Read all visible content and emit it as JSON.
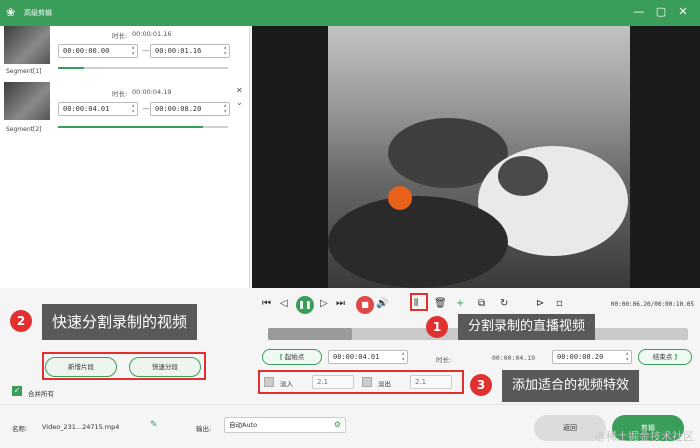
{
  "window": {
    "title": "高级剪辑",
    "logo_glyph": "❀",
    "minimize_glyph": "—",
    "maximize_glyph": "▢",
    "close_glyph": "✕"
  },
  "segments": [
    {
      "label": "Segment[1]",
      "duration_label": "时长:",
      "duration": "00:00:01.16",
      "start": "00:00:00.00",
      "end": "00:00:01.16",
      "progress": 0.15
    },
    {
      "label": "Segment[2]",
      "duration_label": "时长:",
      "duration": "00:00:04.19",
      "start": "00:00:04.01",
      "end": "00:00:08.20",
      "progress": 0.85
    }
  ],
  "controls": {
    "time_readout": "00:00:06.20/00:00:10.05",
    "timeline_progress": 0.2
  },
  "cut_bar": {
    "start_btn": "起始点",
    "start_time": "00:00:04.01",
    "duration_label": "时长:",
    "duration": "00:00:04.19",
    "end_time": "00:00:08.20",
    "end_btn": "结束点"
  },
  "effects": {
    "fade_in_label": "淡入",
    "fade_in_value": "2.1",
    "fade_out_label": "淡出",
    "fade_out_value": "2.1"
  },
  "left_buttons": {
    "new_segment": "新增片段",
    "quick_split": "快速分段",
    "merge_label": "合并所有"
  },
  "callouts": [
    {
      "num": "1",
      "text": "分割录制的直播视频"
    },
    {
      "num": "2",
      "text": "快速分割录制的视频"
    },
    {
      "num": "3",
      "text": "添加适合的视频特效"
    }
  ],
  "footer": {
    "name_label": "名称:",
    "file_name": "Video_231...24715.mp4",
    "output_label": "输出:",
    "output_value": "自动Auto",
    "back_btn": "返回",
    "cut_btn": "剪辑"
  },
  "watermark": "@稀土掘金技术社区",
  "colors": {
    "accent": "#3a9e5a",
    "highlight": "#e03030"
  }
}
